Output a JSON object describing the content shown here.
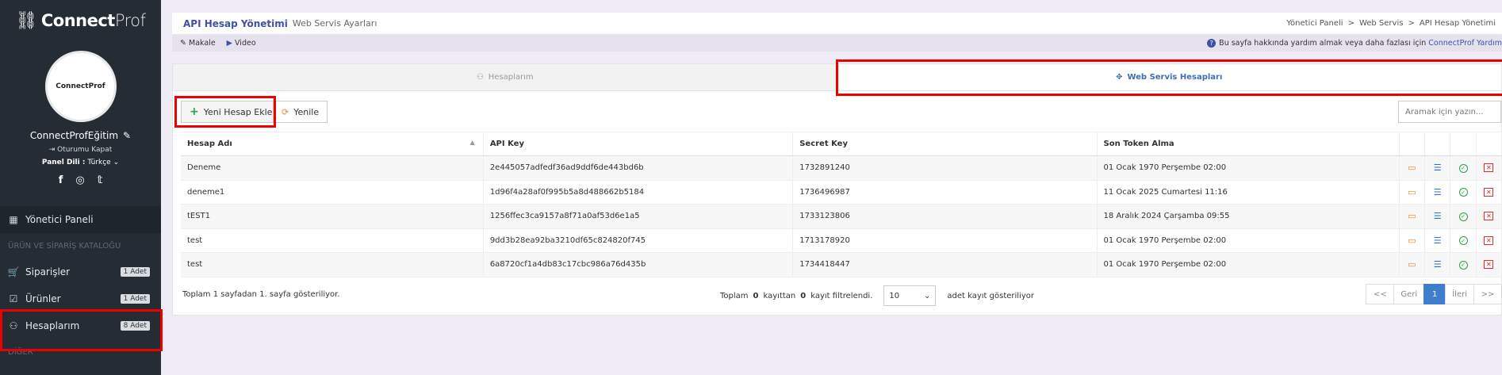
{
  "brand": {
    "bold": "Connect",
    "light": "Prof"
  },
  "profile": {
    "avatar_text": "ConnectProf",
    "username": "ConnectProfEğitim",
    "logout": "Oturumu Kapat",
    "lang_label": "Panel Dili :",
    "lang_value": "Türkçe"
  },
  "nav": {
    "dashboard": "Yönetici Paneli",
    "section1": "ÜRÜN VE SİPARİŞ KATALOĞU",
    "orders": {
      "label": "Siparişler",
      "badge": "1 Adet"
    },
    "products": {
      "label": "Ürünler",
      "badge": "1 Adet"
    },
    "accounts": {
      "label": "Hesaplarım",
      "badge": "8 Adet"
    },
    "section2": "DİĞER"
  },
  "header": {
    "title": "API Hesap Yönetimi",
    "subtitle": "Web Servis Ayarları",
    "crumbs": [
      "Yönetici Paneli",
      "Web Servis",
      "API Hesap Yönetimi"
    ]
  },
  "helpbar": {
    "article": "Makale",
    "video": "Video",
    "help_text": "Bu sayfa hakkında yardım almak veya daha fazlası için",
    "help_link": "ConnectProf Yardım"
  },
  "tabs": {
    "accounts": "Hesaplarım",
    "webservice": "Web Servis Hesapları"
  },
  "toolbar": {
    "add": "Yeni Hesap Ekle",
    "refresh": "Yenile",
    "search_placeholder": "Aramak için yazın..."
  },
  "table": {
    "headers": [
      "Hesap Adı",
      "API Key",
      "Secret Key",
      "Son Token Alma"
    ],
    "rows": [
      [
        "Deneme",
        "2e445057adfedf36ad9ddf6de443bd6b",
        "1732891240",
        "01 Ocak 1970 Perşembe 02:00"
      ],
      [
        "deneme1",
        "1d96f4a28af0f995b5a8d488662b5184",
        "1736496987",
        "11 Ocak 2025 Cumartesi 11:16"
      ],
      [
        "tEST1",
        "1256ffec3ca9157a8f71a0af53d6e1a5",
        "1733123806",
        "18 Aralık 2024 Çarşamba 09:55"
      ],
      [
        "test",
        "9dd3b28ea92ba3210df65c824820f745",
        "1713178920",
        "01 Ocak 1970 Perşembe 02:00"
      ],
      [
        "test",
        "6a8720cf1a4db83c17cbc986a76d435b",
        "1734418447",
        "01 Ocak 1970 Perşembe 02:00"
      ]
    ]
  },
  "footer": {
    "info": "Toplam 1 sayfadan 1. sayfa gösteriliyor.",
    "filter_pre": "Toplam",
    "filter_a": "0",
    "filter_mid": "kayıttan",
    "filter_b": "0",
    "filter_post": "kayıt filtrelendi.",
    "page_size": "10",
    "page_size_suffix": "adet kayıt gösteriliyor",
    "pager": {
      "first": "<<",
      "prev": "Geri",
      "current": "1",
      "next": "İleri",
      "last": ">>"
    }
  }
}
